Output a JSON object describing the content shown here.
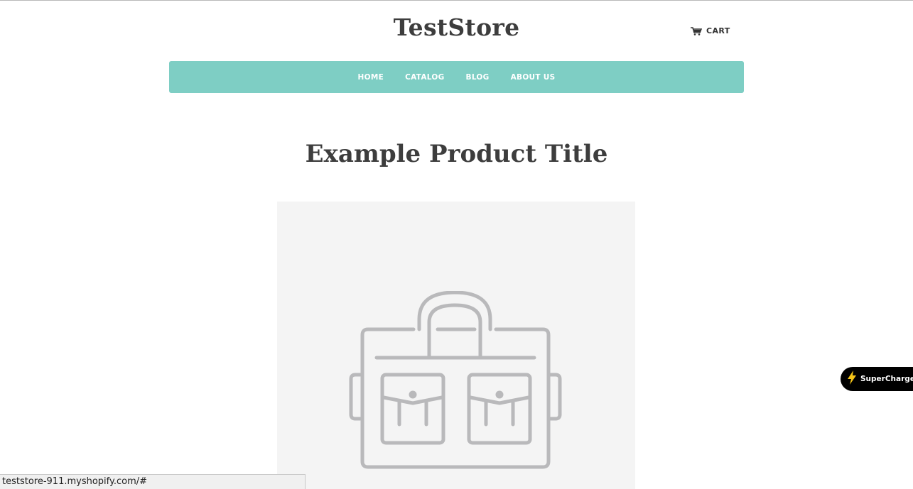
{
  "header": {
    "store_name": "TestStore",
    "cart_label": "CART",
    "cart_icon": "cart-icon"
  },
  "nav": {
    "items": [
      {
        "label": "HOME"
      },
      {
        "label": "CATALOG"
      },
      {
        "label": "BLOG"
      },
      {
        "label": "ABOUT US"
      }
    ],
    "background": "#7ecec4"
  },
  "product": {
    "title": "Example Product Title",
    "image_icon": "bag-placeholder-icon"
  },
  "widget": {
    "label": "SuperCharge",
    "icon": "lightning-icon",
    "accent": "#f5c518"
  },
  "status_bar": {
    "url": "teststore-911.myshopify.com/#"
  }
}
